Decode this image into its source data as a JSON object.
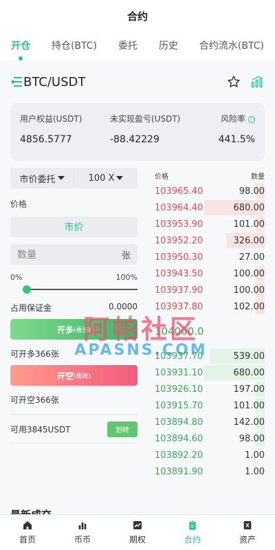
{
  "header": {
    "title": "合约"
  },
  "tabs": [
    {
      "label": "开仓",
      "active": true
    },
    {
      "label": "持仓(BTC)"
    },
    {
      "label": "委托"
    },
    {
      "label": "历史"
    },
    {
      "label": "合约流水(BTC)"
    }
  ],
  "pair": {
    "title": "BTC/USDT",
    "icons": [
      "menu-collapse-icon",
      "star-icon",
      "chart-icon"
    ]
  },
  "summary": {
    "equity_label": "用户权益(USDT)",
    "equity_value": "4856.5777",
    "pnl_label": "未实现盈亏(USDT)",
    "pnl_value": "-88.42229",
    "risk_label": "风险率",
    "risk_value": "441.5%",
    "risk_info_icon": "i"
  },
  "form": {
    "order_type": "市价委托",
    "leverage": "100 X",
    "price_label": "价格",
    "price_value": "市价",
    "qty_placeholder": "数量",
    "qty_unit": "张",
    "slider_min": "0%",
    "slider_max": "100%",
    "slider_fraction": 0.0,
    "margin_label": "占用保证金",
    "margin_value": "0.0000",
    "long_button": "开多",
    "long_button_sub": "(看涨)",
    "long_available": "可开多366张",
    "short_button": "开空",
    "short_button_sub": "(看跌)",
    "short_available": "可开空366张",
    "available_balance": "可用3845USDT",
    "transfer_button": "划转"
  },
  "orderbook": {
    "price_header": "价格",
    "qty_header": "数量",
    "asks": [
      {
        "price": "103965.40",
        "qty": "98.00",
        "depth": 0.08
      },
      {
        "price": "103964.40",
        "qty": "680.00",
        "depth": 0.55
      },
      {
        "price": "103953.90",
        "qty": "101.00",
        "depth": 0.08
      },
      {
        "price": "103952.20",
        "qty": "326.00",
        "depth": 0.35
      },
      {
        "price": "103950.30",
        "qty": "27.00",
        "depth": 0.0
      },
      {
        "price": "103943.50",
        "qty": "100.00",
        "depth": 0.08
      },
      {
        "price": "103937.90",
        "qty": "100.00",
        "depth": 0.08
      },
      {
        "price": "103937.80",
        "qty": "102.00",
        "depth": 0.08
      }
    ],
    "mid_price": "104000.0",
    "bids": [
      {
        "price": "103937.70",
        "qty": "539.00",
        "depth": 0.5
      },
      {
        "price": "103931.10",
        "qty": "680.00",
        "depth": 0.55
      },
      {
        "price": "103926.10",
        "qty": "197.00",
        "depth": 0.08
      },
      {
        "price": "103915.70",
        "qty": "101.00",
        "depth": 0.08
      },
      {
        "price": "103894.80",
        "qty": "142.00",
        "depth": 0.08
      },
      {
        "price": "103894.60",
        "qty": "98.00",
        "depth": 0.08
      },
      {
        "price": "103892.20",
        "qty": "1.00",
        "depth": 0.0
      },
      {
        "price": "103891.90",
        "qty": "1.00",
        "depth": 0.0
      }
    ]
  },
  "recent_trades": {
    "title": "最新成交"
  },
  "watermark": {
    "line1": "阿帕社区",
    "line2": "APASNS.COM"
  },
  "bottom_nav": [
    {
      "label": "首页",
      "icon": "home-icon"
    },
    {
      "label": "币币",
      "icon": "bar-chart-icon"
    },
    {
      "label": "期权",
      "icon": "trend-icon"
    },
    {
      "label": "合约",
      "icon": "clipboard-icon",
      "active": true
    },
    {
      "label": "资产",
      "icon": "wallet-icon"
    }
  ],
  "colors": {
    "accent": "#2bbf8e",
    "ask": "#e04b4b",
    "bid": "#3aa655"
  }
}
